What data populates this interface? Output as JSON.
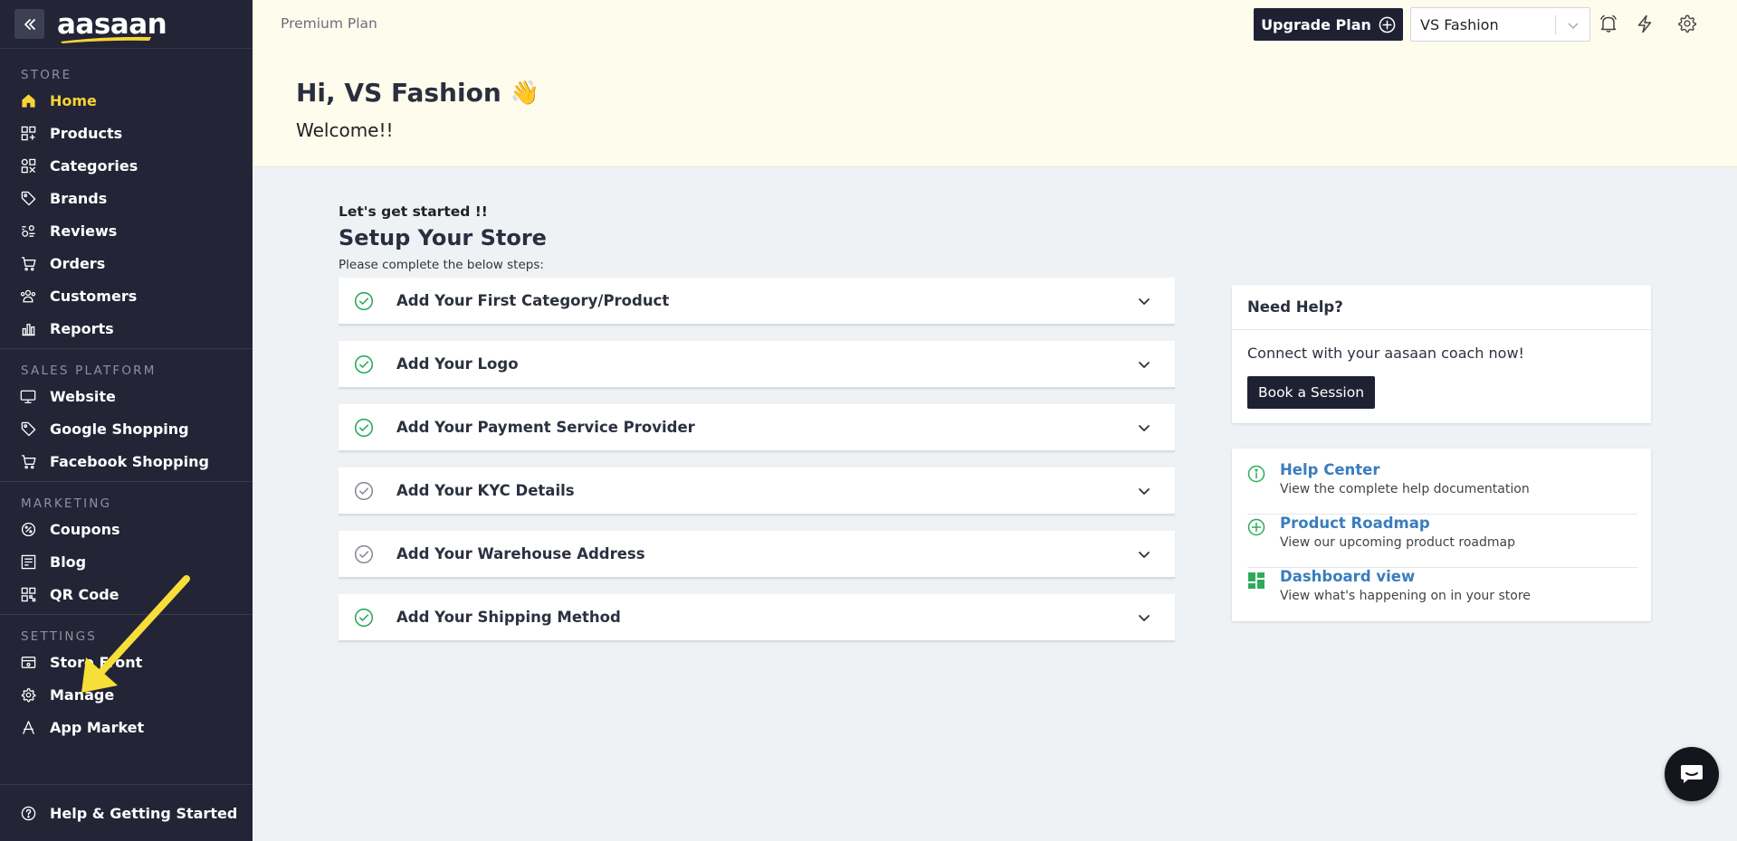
{
  "brand": {
    "logo_text": "aasaan",
    "accent": "#f7d434",
    "sidebar_bg": "#232536"
  },
  "sidebar": {
    "sections": [
      {
        "label": "STORE",
        "items": [
          {
            "label": "Home",
            "icon": "home-icon",
            "active": true
          },
          {
            "label": "Products",
            "icon": "products-icon"
          },
          {
            "label": "Categories",
            "icon": "categories-icon"
          },
          {
            "label": "Brands",
            "icon": "tag-icon"
          },
          {
            "label": "Reviews",
            "icon": "reviews-icon"
          },
          {
            "label": "Orders",
            "icon": "cart-icon"
          },
          {
            "label": "Customers",
            "icon": "customers-icon"
          },
          {
            "label": "Reports",
            "icon": "reports-icon"
          }
        ]
      },
      {
        "label": "SALES PLATFORM",
        "items": [
          {
            "label": "Website",
            "icon": "monitor-icon"
          },
          {
            "label": "Google Shopping",
            "icon": "google-tag-icon"
          },
          {
            "label": "Facebook Shopping",
            "icon": "cart-icon"
          }
        ]
      },
      {
        "label": "MARKETING",
        "items": [
          {
            "label": "Coupons",
            "icon": "coupon-icon"
          },
          {
            "label": "Blog",
            "icon": "blog-icon"
          },
          {
            "label": "QR Code",
            "icon": "qr-icon"
          }
        ]
      },
      {
        "label": "SETTINGS",
        "items": [
          {
            "label": "Store Front",
            "icon": "storefront-icon"
          },
          {
            "label": "Manage",
            "icon": "gear-icon"
          },
          {
            "label": "App Market",
            "icon": "app-market-icon"
          }
        ]
      }
    ],
    "bottom_item": {
      "label": "Help & Getting Started",
      "icon": "help-icon"
    }
  },
  "header": {
    "plan": "Premium Plan",
    "upgrade_label": "Upgrade Plan",
    "store_selected": "VS Fashion",
    "greeting": "Hi, VS Fashion",
    "greeting_emoji": "👋",
    "welcome": "Welcome!!"
  },
  "setup": {
    "pre_title": "Let's get started !!",
    "title": "Setup Your Store",
    "subtitle": "Please complete the below steps:",
    "steps": [
      {
        "label": "Add Your First Category/Product",
        "done": true
      },
      {
        "label": "Add Your Logo",
        "done": true
      },
      {
        "label": "Add Your Payment Service Provider",
        "done": true
      },
      {
        "label": "Add Your KYC Details",
        "done": false
      },
      {
        "label": "Add Your Warehouse Address",
        "done": false
      },
      {
        "label": "Add Your Shipping Method",
        "done": true
      }
    ],
    "done_color": "#2eaa5c",
    "pending_color": "#8a8d96"
  },
  "help": {
    "title": "Need Help?",
    "text": "Connect with your aasaan coach now!",
    "button": "Book a Session"
  },
  "links": [
    {
      "title": "Help Center",
      "desc": "View the complete help documentation",
      "icon": "info-icon"
    },
    {
      "title": "Product Roadmap",
      "desc": "View our upcoming product roadmap",
      "icon": "plus-circle-icon"
    },
    {
      "title": "Dashboard view",
      "desc": "View what's happening on in your store",
      "icon": "dashboard-icon"
    }
  ]
}
